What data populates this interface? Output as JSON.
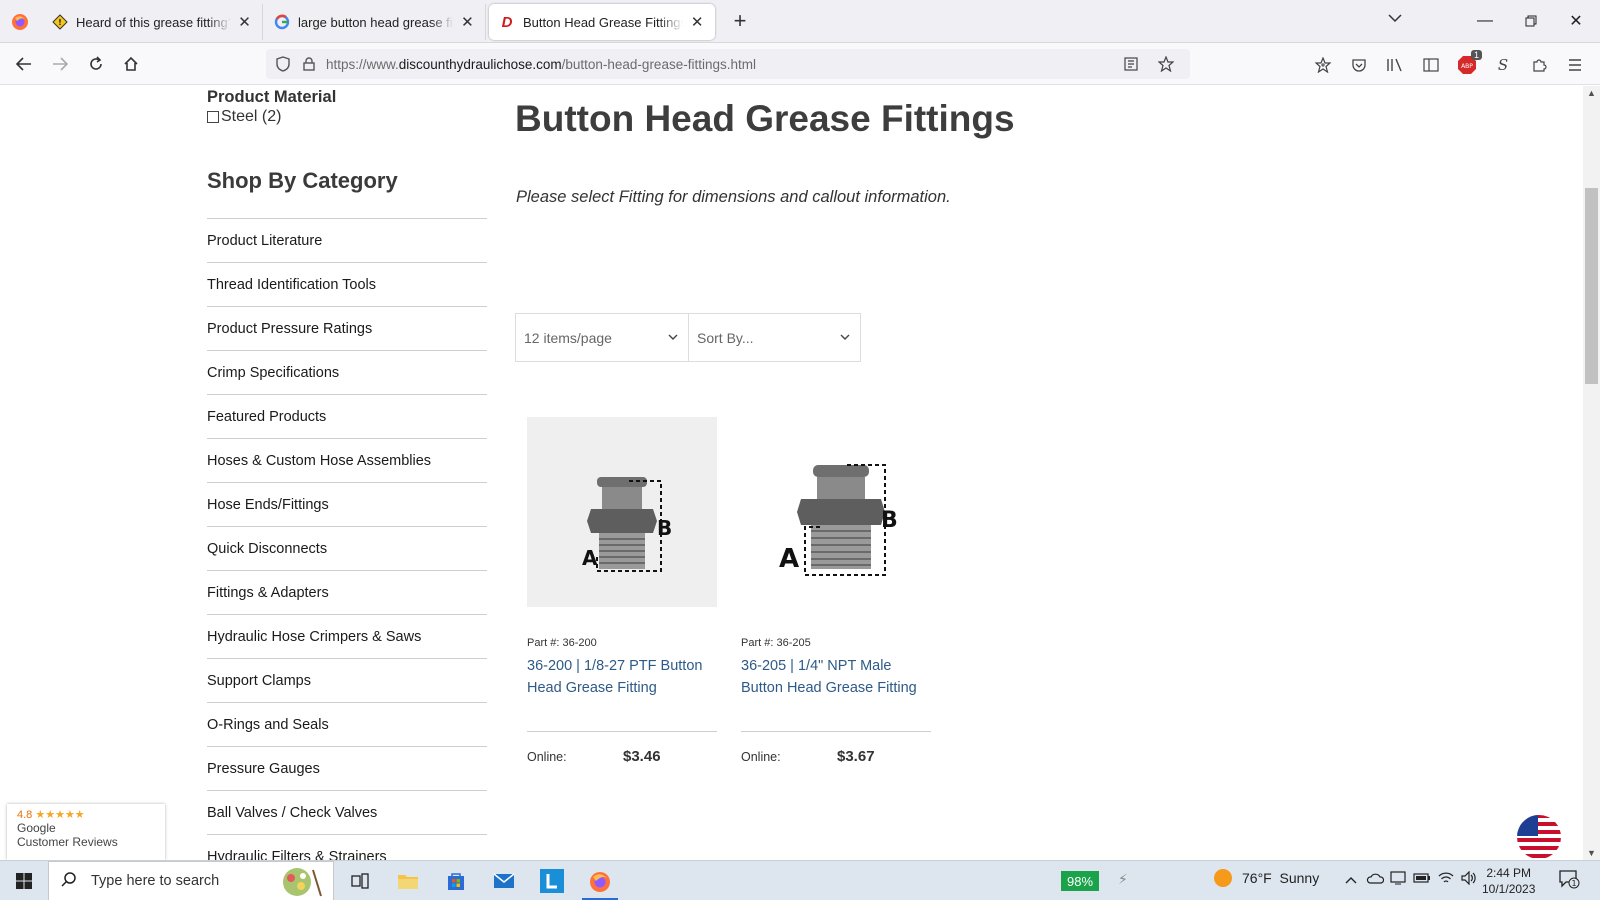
{
  "browser": {
    "tabs": [
      {
        "title": "Heard of this grease fitting? - Tr",
        "icon": "warning-sign-icon",
        "active": false
      },
      {
        "title": "large button head grease fitting",
        "icon": "google-icon",
        "active": false
      },
      {
        "title": "Button Head Grease Fittings: Di",
        "icon": "site-d-icon",
        "active": true
      }
    ],
    "url": {
      "scheme": "https://www.",
      "domain": "discounthydraulichose.com",
      "path": "/button-head-grease-fittings.html"
    },
    "addon_badge": "1",
    "addon_label": "ABP"
  },
  "filters": {
    "material_title": "Product Material",
    "material_option": "Steel (2)"
  },
  "sidebar": {
    "title": "Shop By Category",
    "items": [
      "Product Literature",
      "Thread Identification Tools",
      "Product Pressure Ratings",
      "Crimp Specifications",
      "Featured Products",
      "Hoses & Custom Hose Assemblies",
      "Hose Ends/Fittings",
      "Quick Disconnects",
      "Fittings & Adapters",
      "Hydraulic Hose Crimpers & Saws",
      "Support Clamps",
      "O-Rings and Seals",
      "Pressure Gauges",
      "Ball Valves / Check Valves",
      "Hydraulic Filters & Strainers"
    ]
  },
  "main": {
    "title": "Button Head Grease Fittings",
    "note": "Please select Fitting for dimensions and callout information.",
    "per_page": "12 items/page",
    "sort": "Sort By..."
  },
  "products": [
    {
      "part": "Part #: 36-200",
      "name": "36-200 | 1/8-27 PTF Button Head Grease Fitting",
      "online_label": "Online:",
      "price": "$3.46",
      "dim_a": "A",
      "dim_b": "B"
    },
    {
      "part": "Part #: 36-205",
      "name": "36-205 | 1/4\" NPT Male Button Head Grease Fitting",
      "online_label": "Online:",
      "price": "$3.67",
      "dim_a": "A",
      "dim_b": "B"
    }
  ],
  "reviews": {
    "rating": "4.8",
    "stars": "★★★★★",
    "source": "Google",
    "label": "Customer Reviews"
  },
  "taskbar": {
    "search_placeholder": "Type here to search",
    "battery": "98%",
    "weather": "76°F  Sunny",
    "time": "2:44 PM",
    "date": "10/1/2023",
    "notifications": "1"
  }
}
